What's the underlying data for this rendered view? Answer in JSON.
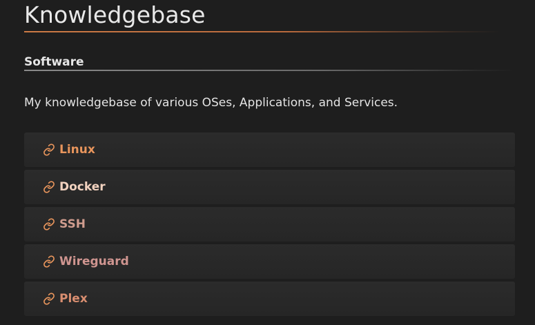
{
  "page": {
    "title": "Knowledgebase",
    "section_heading": "Software",
    "intro": "My knowledgebase of various OSes, Applications, and Services."
  },
  "links": [
    {
      "label": "Linux",
      "icon": "link-icon",
      "color": "#e8955c"
    },
    {
      "label": "Docker",
      "icon": "link-icon",
      "color": "#f2d2bf"
    },
    {
      "label": "SSH",
      "icon": "link-icon",
      "color": "#cf9c8e"
    },
    {
      "label": "Wireguard",
      "icon": "link-icon",
      "color": "#cf9590"
    },
    {
      "label": "Plex",
      "icon": "link-icon",
      "color": "#d98e70"
    }
  ],
  "colors": {
    "background": "#1e1e1e",
    "accent": "#cc7a45",
    "icon": "#e8955c"
  }
}
